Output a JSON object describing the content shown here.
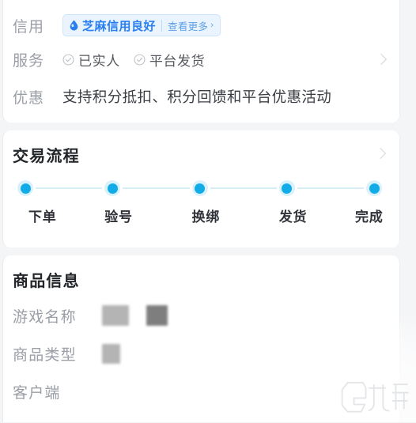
{
  "info_card": {
    "rows": [
      {
        "label": "信用",
        "badge": {
          "icon": "sesame-drop-icon",
          "text": "芝麻信用良好",
          "more": "查看更多",
          "chevron": "›"
        }
      },
      {
        "label": "服务",
        "services": [
          {
            "icon": "circle-check-icon",
            "text": "已实人"
          },
          {
            "icon": "circle-check-icon",
            "text": "平台发货"
          }
        ]
      },
      {
        "label": "优惠",
        "text": "支持积分抵扣、积分回馈和平台优惠活动"
      }
    ]
  },
  "flow_card": {
    "title": "交易流程",
    "steps": [
      "下单",
      "验号",
      "换绑",
      "发货",
      "完成"
    ]
  },
  "goods_card": {
    "title": "商品信息",
    "rows": [
      {
        "label": "游戏名称",
        "value": ""
      },
      {
        "label": "商品类型",
        "value": ""
      },
      {
        "label": "客户端",
        "value": ""
      }
    ]
  },
  "watermark": {
    "brand": "九游",
    "logo": "G"
  },
  "colors": {
    "accent_blue": "#11ACE8",
    "badge_blue": "#2a7ff0",
    "badge_bg": "#eaf4fe",
    "track": "#d7eef7",
    "label_gray": "#9a9ea6",
    "title_dark": "#222529",
    "page_bg": "#f4f5f7"
  }
}
